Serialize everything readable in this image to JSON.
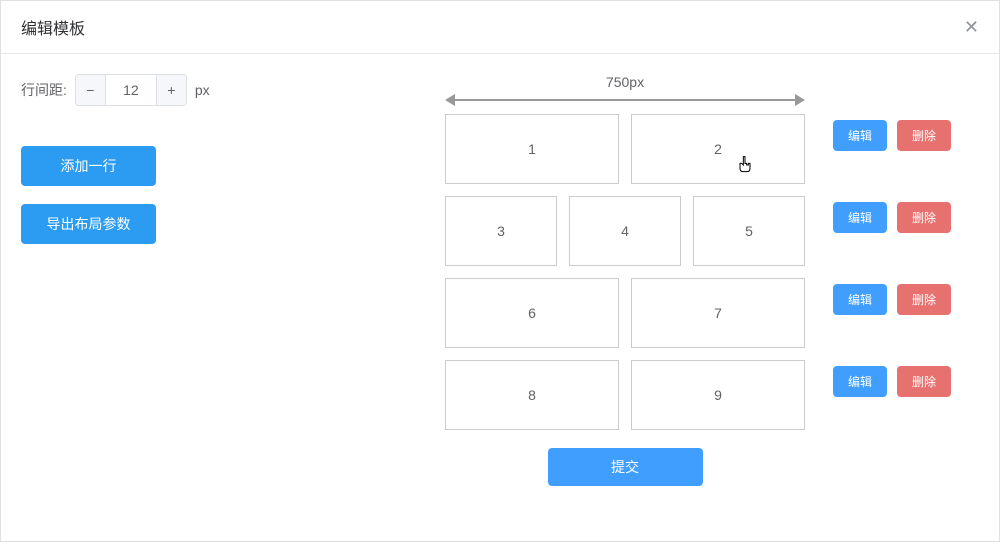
{
  "modal": {
    "title": "编辑模板"
  },
  "left": {
    "spacing_label": "行间距:",
    "spacing_value": "12",
    "spacing_unit": "px",
    "add_row_label": "添加一行",
    "export_label": "导出布局参数"
  },
  "ruler": {
    "width_label": "750px"
  },
  "layout": {
    "rows": [
      {
        "cells": [
          "1",
          "2"
        ],
        "widths": [
          174,
          174
        ]
      },
      {
        "cells": [
          "3",
          "4",
          "5"
        ],
        "widths": [
          112,
          112,
          112
        ]
      },
      {
        "cells": [
          "6",
          "7"
        ],
        "widths": [
          174,
          174
        ]
      },
      {
        "cells": [
          "8",
          "9"
        ],
        "widths": [
          174,
          174
        ]
      }
    ]
  },
  "actions": {
    "edit_label": "编辑",
    "delete_label": "删除"
  },
  "footer": {
    "submit_label": "提交"
  }
}
